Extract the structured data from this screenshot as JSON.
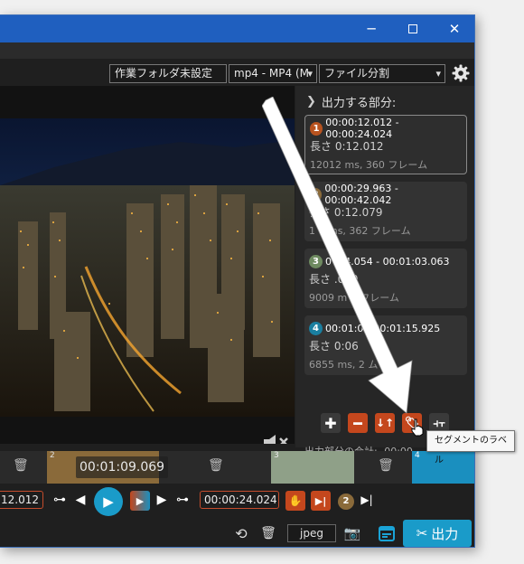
{
  "toolbar": {
    "workdir_label": "作業フォルダ未設定",
    "format_value": "mp4 - MP4 (M",
    "mode_value": "ファイル分割"
  },
  "sidebar": {
    "header": "出力する部分:",
    "segments": [
      {
        "num": "1",
        "range": "00:00:12.012 - 00:00:24.024",
        "length": "長さ 0:12.012",
        "detail": "12012 ms, 360 フレーム",
        "color": "#b8531f"
      },
      {
        "num": "2",
        "range": "00:00:29.963 - 00:00:42.042",
        "length": "長さ 0:12.079",
        "detail": "1   8 ms, 362 フレーム",
        "color": "#8a6a3a"
      },
      {
        "num": "3",
        "range": "0    :54.054 - 00:01:03.063",
        "length": "長さ     .009",
        "detail": "9009 m     0 フレーム",
        "color": "#6e8a60"
      },
      {
        "num": "4",
        "range": "00:01:0        - 00:01:15.925",
        "length": "長さ 0:06",
        "detail": "6855 ms, 2           ム",
        "color": "#1a7fa0"
      }
    ],
    "total_label": "出力部分の合計:",
    "total_value": "00:00"
  },
  "tooltip": "セグメントのラベル",
  "timeline": {
    "current_time": "00:01:09.069",
    "seg2_label": "2",
    "seg3_label": "3",
    "seg4_label": "4"
  },
  "controls": {
    "start_time": "12.012",
    "end_time": "00:00:24.024",
    "segment_badge": "2"
  },
  "bottom": {
    "image_format": "jpeg",
    "export_label": "出力"
  },
  "colors": {
    "accent": "#1a8fbf",
    "segment_red": "#c4471d",
    "seg2_fill": "#8a6a3a",
    "seg3_fill": "#8fa088",
    "seg4_fill": "#1a8fbf"
  }
}
